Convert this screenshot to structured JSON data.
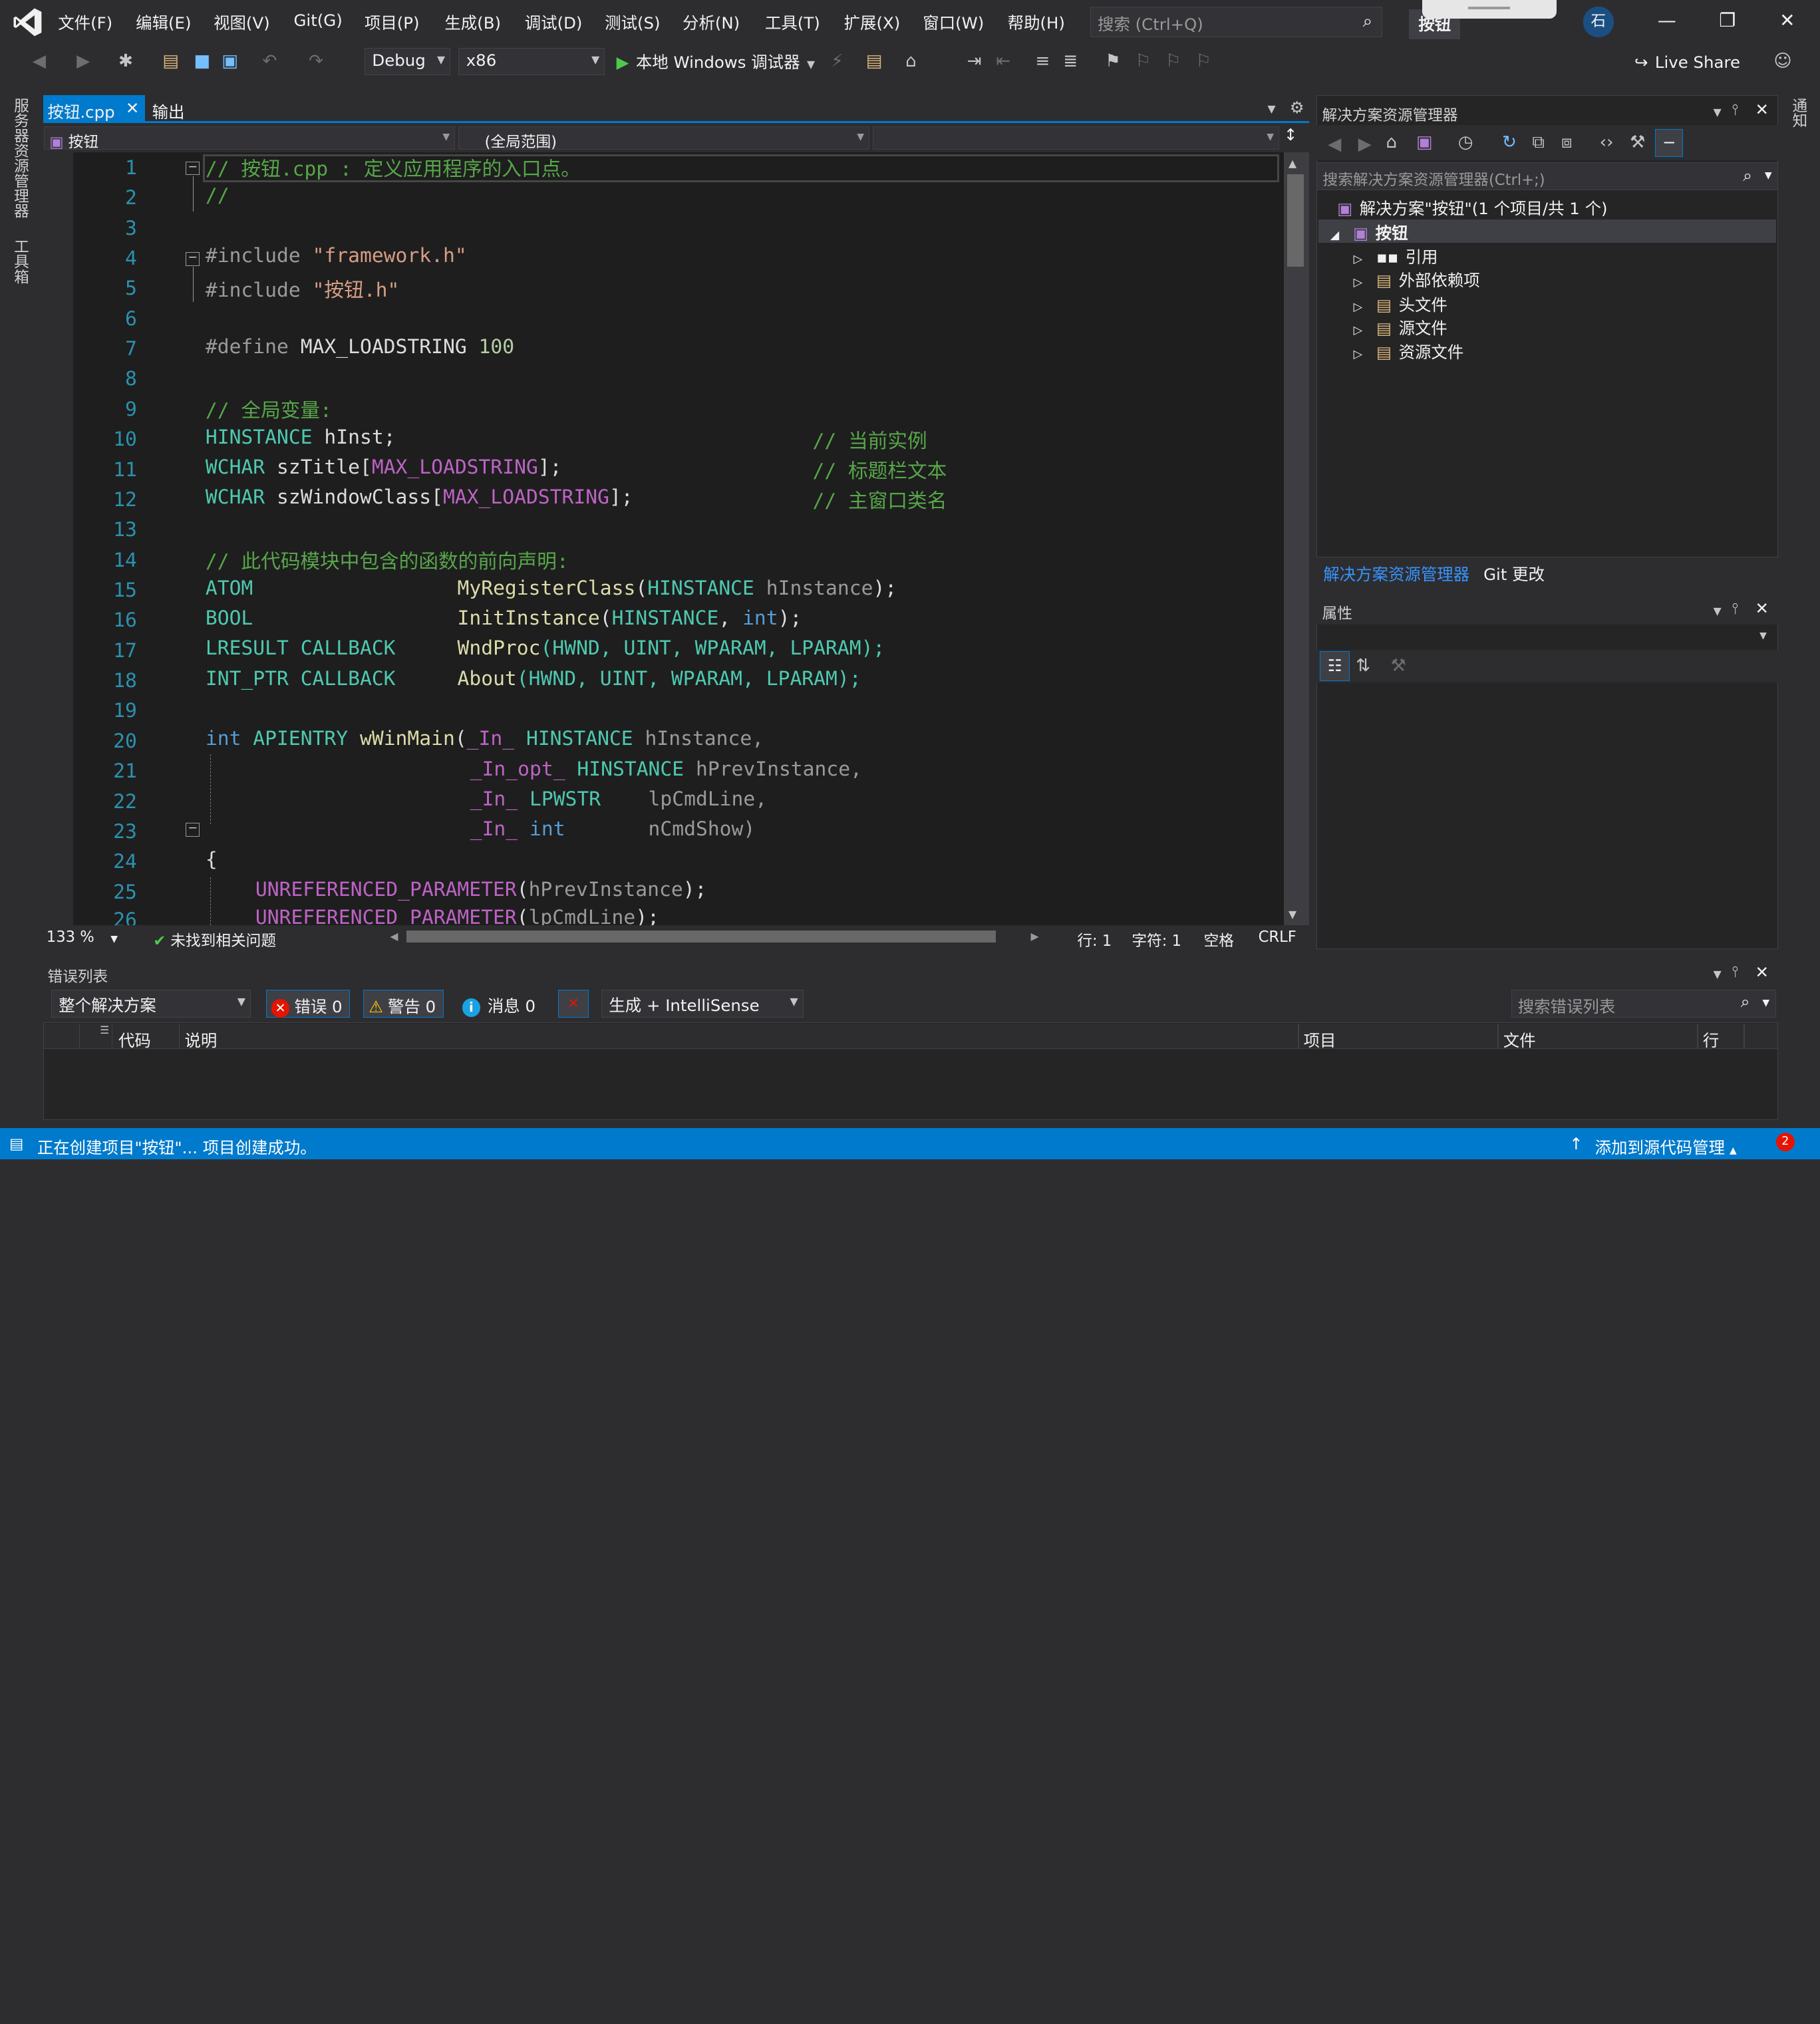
{
  "menu": {
    "items": [
      "文件(F)",
      "编辑(E)",
      "视图(V)",
      "Git(G)",
      "项目(P)",
      "生成(B)",
      "调试(D)",
      "测试(S)",
      "分析(N)",
      "工具(T)",
      "扩展(X)",
      "窗口(W)",
      "帮助(H)"
    ],
    "search_placeholder": "搜索 (Ctrl+Q)",
    "project_name": "按钮",
    "avatar_initial": "石"
  },
  "toolbar": {
    "config": "Debug",
    "platform": "x86",
    "run_label": "本地 Windows 调试器",
    "live_share": "Live Share"
  },
  "left_strip": {
    "server_explorer": "服务器资源管理器",
    "toolbox": "工具箱"
  },
  "right_strip": {
    "notifications": "通知"
  },
  "editor": {
    "tabs": [
      {
        "label": "按钮.cpp",
        "active": true
      },
      {
        "label": "输出",
        "active": false
      }
    ],
    "nav": {
      "project": "按钮",
      "scope": "(全局范围)",
      "member": ""
    },
    "lines": [
      {
        "n": "1"
      },
      {
        "n": "2"
      },
      {
        "n": "3"
      },
      {
        "n": "4"
      },
      {
        "n": "5"
      },
      {
        "n": "6"
      },
      {
        "n": "7"
      },
      {
        "n": "8"
      },
      {
        "n": "9"
      },
      {
        "n": "10"
      },
      {
        "n": "11"
      },
      {
        "n": "12"
      },
      {
        "n": "13"
      },
      {
        "n": "14"
      },
      {
        "n": "15"
      },
      {
        "n": "16"
      },
      {
        "n": "17"
      },
      {
        "n": "18"
      },
      {
        "n": "19"
      },
      {
        "n": "20"
      },
      {
        "n": "21"
      },
      {
        "n": "22"
      },
      {
        "n": "23"
      },
      {
        "n": "24"
      },
      {
        "n": "25"
      },
      {
        "n": "26"
      }
    ],
    "code": {
      "l1": "// 按钮.cpp : 定义应用程序的入口点。",
      "l2": "//",
      "l4a": "#include ",
      "l4b": "\"framework.h\"",
      "l5a": "#include ",
      "l5b": "\"按钮.h\"",
      "l7a": "#define ",
      "l7b": "MAX_LOADSTRING",
      "l7c": " 100",
      "l9": "// 全局变量:",
      "l10a": "HINSTANCE",
      "l10b": " hInst;",
      "l10c": "// 当前实例",
      "l11a": "WCHAR",
      "l11b": " szTitle[",
      "l11c": "MAX_LOADSTRING",
      "l11d": "];",
      "l11e": "// 标题栏文本",
      "l12a": "WCHAR",
      "l12b": " szWindowClass[",
      "l12c": "MAX_LOADSTRING",
      "l12d": "];",
      "l12e": "// 主窗口类名",
      "l14": "// 此代码模块中包含的函数的前向声明:",
      "l15a": "ATOM",
      "l15b": "MyRegisterClass",
      "l15c": "(",
      "l15d": "HINSTANCE",
      "l15e": " hInstance",
      "l15f": ");",
      "l16a": "BOOL",
      "l16b": "InitInstance",
      "l16c": "(",
      "l16d": "HINSTANCE",
      "l16e": ", ",
      "l16f": "int",
      "l16g": ");",
      "l17a": "LRESULT CALLBACK",
      "l17b": "WndProc",
      "l17c": "(HWND, UINT, WPARAM, LPARAM);",
      "l18a": "INT_PTR CALLBACK",
      "l18b": "About",
      "l18c": "(HWND, UINT, WPARAM, LPARAM);",
      "l20a": "int",
      "l20b": " APIENTRY ",
      "l20c": "wWinMain",
      "l20d": "(",
      "l20e": "_In_",
      "l20f": " HINSTANCE",
      "l20g": " hInstance,",
      "l21a": "_In_opt_",
      "l21b": " HINSTANCE",
      "l21c": " hPrevInstance,",
      "l22a": "_In_",
      "l22b": " LPWSTR",
      "l22c": "    lpCmdLine,",
      "l23a": "_In_",
      "l23b": " int",
      "l23c": "       nCmdShow)",
      "l24": "{",
      "l25a": "UNREFERENCED_PARAMETER",
      "l25b": "(",
      "l25c": "hPrevInstance",
      "l25d": ");",
      "l26a": "UNREFERENCED_PARAMETER",
      "l26b": "(",
      "l26c": "lpCmdLine",
      "l26d": ");"
    },
    "status": {
      "zoom": "133 %",
      "issues": "未找到相关问题",
      "line": "行: 1",
      "col": "字符: 1",
      "spaces": "空格",
      "eol": "CRLF"
    }
  },
  "solution_explorer": {
    "title": "解决方案资源管理器",
    "search_placeholder": "搜索解决方案资源管理器(Ctrl+;)",
    "solution_label": "解决方案\"按钮\"(1 个项目/共 1 个)",
    "project_label": "按钮",
    "nodes": [
      "引用",
      "外部依赖项",
      "头文件",
      "源文件",
      "资源文件"
    ],
    "tab_active": "解决方案资源管理器",
    "tab_git": "Git 更改"
  },
  "properties": {
    "title": "属性"
  },
  "error_list": {
    "title": "错误列表",
    "scope": "整个解决方案",
    "errors": "错误 0",
    "warnings": "警告 0",
    "messages": "消息 0",
    "build_filter": "生成 + IntelliSense",
    "search_placeholder": "搜索错误列表",
    "columns": [
      "代码",
      "说明",
      "项目",
      "文件",
      "行"
    ]
  },
  "statusbar": {
    "text": "正在创建项目\"按钮\"... 项目创建成功。",
    "source_control": "添加到源代码管理",
    "notification_count": "2",
    "colors": {
      "background": "#007acc"
    }
  },
  "colors": {
    "accent": "#007acc",
    "comment": "#57a64a",
    "keyword": "#569cd6",
    "string": "#d69d85",
    "type": "#4ec9b0",
    "function": "#dcdcaa",
    "macro": "#bd63c5",
    "line_number": "#2b91af"
  }
}
